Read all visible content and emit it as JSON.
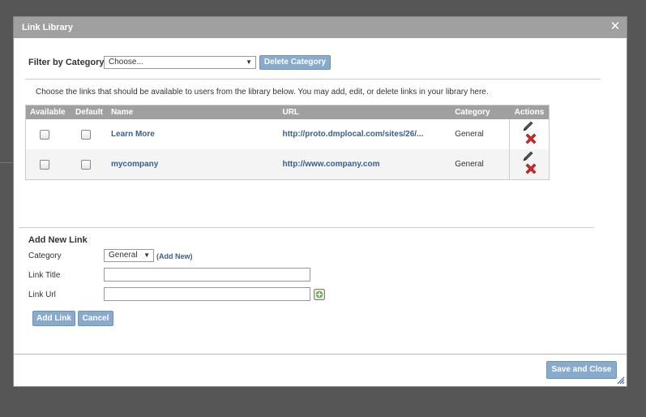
{
  "dialog": {
    "title": "Link Library",
    "close_symbol": "✕"
  },
  "filter": {
    "label": "Filter by Category:",
    "selected": "Choose...",
    "delete_button": "Delete Category"
  },
  "intro_text": "Choose the links that should be available to users from the library below. You may add, edit, or delete links in your library here.",
  "table": {
    "headers": [
      "Available",
      "Default",
      "Name",
      "URL",
      "Category",
      "Actions"
    ],
    "rows": [
      {
        "name": "Learn More",
        "url": "http://proto.dmplocal.com/sites/26/...",
        "category": "General"
      },
      {
        "name": "mycompany",
        "url": "http://www.company.com",
        "category": "General"
      }
    ]
  },
  "add_link": {
    "section_title": "Add New Link",
    "category_label": "Category",
    "category_value": "General",
    "add_new_label": "(Add New)",
    "title_label": "Link Title",
    "title_value": "",
    "url_label": "Link Url",
    "url_value": "",
    "add_button": "Add Link",
    "cancel_button": "Cancel"
  },
  "footer": {
    "save_close_button": "Save and Close"
  },
  "icons": {
    "close": "close-icon",
    "edit": "pencil-icon",
    "delete": "red-x-icon",
    "lookup": "link-lookup-icon",
    "resize": "resize-grip-icon"
  },
  "colors": {
    "titlebar": "#a0a0a0",
    "button": "#88aacc",
    "link": "#3a5f8a",
    "delete": "#d42a2a"
  }
}
